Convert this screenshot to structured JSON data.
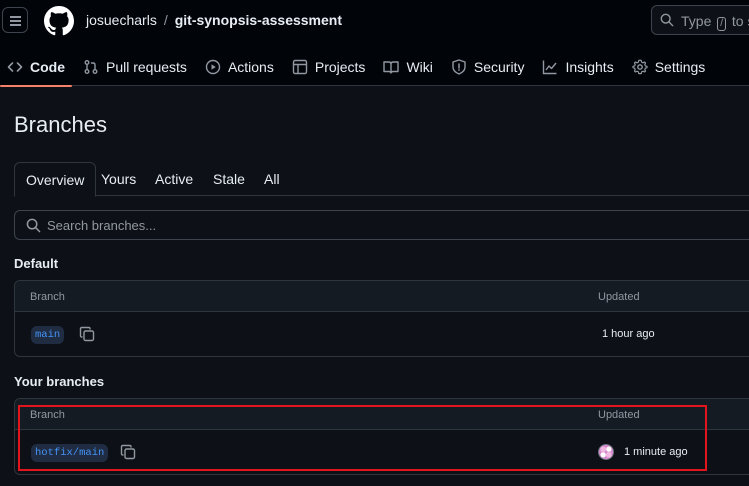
{
  "header": {
    "owner": "josuecharls",
    "separator": "/",
    "repo": "git-synopsis-assessment",
    "search": {
      "prefix": "Type",
      "key": "/",
      "suffix": "to se"
    }
  },
  "nav": {
    "tabs": [
      {
        "label": "Code",
        "icon": "code-icon",
        "selected": true
      },
      {
        "label": "Pull requests",
        "icon": "pull-request-icon"
      },
      {
        "label": "Actions",
        "icon": "play-icon"
      },
      {
        "label": "Projects",
        "icon": "table-icon"
      },
      {
        "label": "Wiki",
        "icon": "book-icon"
      },
      {
        "label": "Security",
        "icon": "shield-icon"
      },
      {
        "label": "Insights",
        "icon": "graph-icon"
      },
      {
        "label": "Settings",
        "icon": "gear-icon"
      }
    ]
  },
  "page": {
    "title": "Branches",
    "subtabs": [
      "Overview",
      "Yours",
      "Active",
      "Stale",
      "All"
    ],
    "search_placeholder": "Search branches..."
  },
  "default_section": {
    "title": "Default",
    "col_branch": "Branch",
    "col_updated": "Updated",
    "rows": [
      {
        "branch": "main",
        "updated": "1 hour ago"
      }
    ]
  },
  "your_section": {
    "title": "Your branches",
    "col_branch": "Branch",
    "col_updated": "Updated",
    "rows": [
      {
        "branch": "hotfix/main",
        "updated": "1 minute ago"
      }
    ]
  },
  "colors": {
    "background": "#0d1117",
    "header_bg": "#010409",
    "accent_underline": "#f78166",
    "branch_pill_text": "#4493f8",
    "highlight_box": "#e3141c"
  }
}
